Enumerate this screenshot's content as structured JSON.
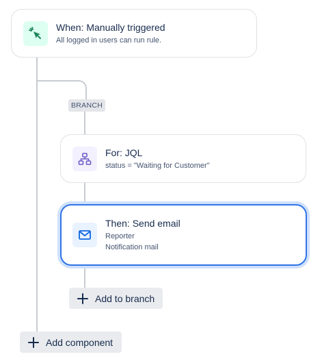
{
  "trigger": {
    "title": "When: Manually triggered",
    "subtitle": "All logged in users can run rule.",
    "icon": "pointer-click-icon"
  },
  "branch": {
    "tag": "BRANCH",
    "for_card": {
      "title": "For: JQL",
      "subtitle": "status = \"Waiting for Customer\"",
      "icon": "hierarchy-icon"
    },
    "action_card": {
      "title": "Then: Send email",
      "line1": "Reporter",
      "line2": "Notification mail",
      "icon": "email-icon"
    },
    "add_to_branch_label": "Add to branch"
  },
  "add_component_label": "Add component",
  "colors": {
    "accent": "#2f74e6",
    "trigger_icon_bg": "#dcfff1",
    "trigger_icon": "#1f845a",
    "branch_icon_bg": "#f3f0ff",
    "branch_icon": "#6e5dc6",
    "email_icon_bg": "#e9f2ff",
    "email_icon": "#0c66e4"
  }
}
